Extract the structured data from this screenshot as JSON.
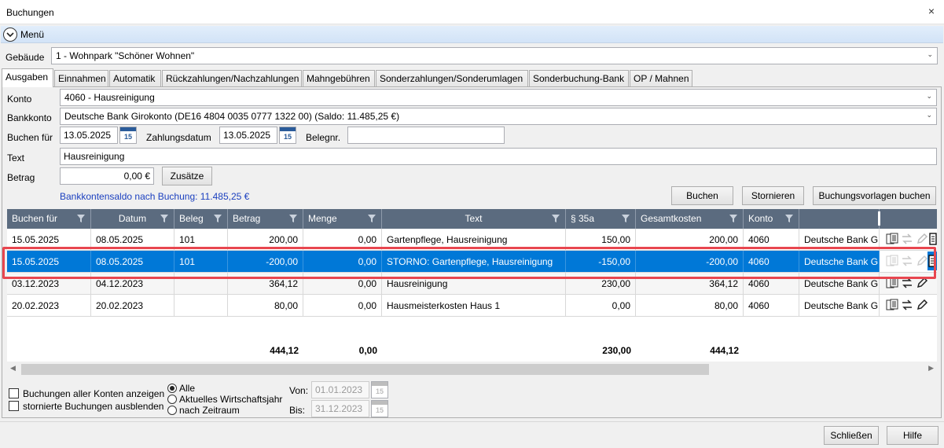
{
  "window": {
    "title": "Buchungen",
    "close_symbol": "×"
  },
  "menu": {
    "label": "Menü"
  },
  "building": {
    "label": "Gebäude",
    "value": "1 - Wohnpark \"Schöner Wohnen\""
  },
  "tabs": [
    {
      "label": "Ausgaben"
    },
    {
      "label": "Einnahmen"
    },
    {
      "label": "Automatik"
    },
    {
      "label": "Rückzahlungen/Nachzahlungen"
    },
    {
      "label": "Mahngebühren"
    },
    {
      "label": "Sonderzahlungen/Sonderumlagen"
    },
    {
      "label": "Sonderbuchung-Bank"
    },
    {
      "label": "OP / Mahnen"
    }
  ],
  "form": {
    "konto_label": "Konto",
    "konto_value": "4060 - Hausreinigung",
    "bankkonto_label": "Bankkonto",
    "bankkonto_value": "Deutsche Bank Girokonto (DE16 4804 0035 0777 1322 00) (Saldo: 11.485,25 €)",
    "buchen_fuer_label": "Buchen für",
    "buchen_fuer_value": "13.05.2025",
    "zahlungsdatum_label": "Zahlungsdatum",
    "zahlungsdatum_value": "13.05.2025",
    "belegnr_label": "Belegnr.",
    "belegnr_value": "",
    "text_label": "Text",
    "text_value": "Hausreinigung",
    "betrag_label": "Betrag",
    "betrag_value": "0,00 €",
    "zusaetze_button": "Zusätze",
    "saldo_info": "Bankkontensaldo nach Buchung: 11.485,25 €",
    "calendar_number": "15"
  },
  "buttons": {
    "buchen": "Buchen",
    "stornieren": "Stornieren",
    "vorlagen": "Buchungsvorlagen buchen",
    "schliessen": "Schließen",
    "hilfe": "Hilfe"
  },
  "grid": {
    "headers": [
      "Buchen für",
      "Datum",
      "Beleg",
      "Betrag",
      "Menge",
      "Text",
      "§ 35a",
      "Gesamtkosten",
      "Konto",
      ""
    ],
    "rows": [
      {
        "buchen_fuer": "15.05.2025",
        "datum": "08.05.2025",
        "beleg": "101",
        "betrag": "200,00",
        "menge": "0,00",
        "text": "Gartenpflege, Hausreinigung",
        "p35a": "150,00",
        "gesamtkosten": "200,00",
        "konto": "4060",
        "bank": "Deutsche Bank G"
      },
      {
        "buchen_fuer": "15.05.2025",
        "datum": "08.05.2025",
        "beleg": "101",
        "betrag": "-200,00",
        "menge": "0,00",
        "text": "STORNO: Gartenpflege, Hausreinigung",
        "p35a": "-150,00",
        "gesamtkosten": "-200,00",
        "konto": "4060",
        "bank": "Deutsche Bank G"
      },
      {
        "buchen_fuer": "03.12.2023",
        "datum": "04.12.2023",
        "beleg": "",
        "betrag": "364,12",
        "menge": "0,00",
        "text": "Hausreinigung",
        "p35a": "230,00",
        "gesamtkosten": "364,12",
        "konto": "4060",
        "bank": "Deutsche Bank G"
      },
      {
        "buchen_fuer": "20.02.2023",
        "datum": "20.02.2023",
        "beleg": "",
        "betrag": "80,00",
        "menge": "0,00",
        "text": "Hausmeisterkosten Haus 1",
        "p35a": "0,00",
        "gesamtkosten": "80,00",
        "konto": "4060",
        "bank": "Deutsche Bank G"
      }
    ],
    "totals": {
      "betrag": "444,12",
      "menge": "0,00",
      "p35a": "230,00",
      "gesamtkosten": "444,12"
    }
  },
  "options": {
    "all_accounts": "Buchungen aller Konten anzeigen",
    "hide_cancelled": "stornierte Buchungen ausblenden",
    "radio_all": "Alle",
    "radio_year": "Aktuelles Wirtschaftsjahr",
    "radio_period": "nach Zeitraum",
    "von_label": "Von:",
    "von_value": "01.01.2023",
    "bis_label": "Bis:",
    "bis_value": "31.12.2023"
  },
  "colors": {
    "accent": "#0078d7",
    "header": "#5b6b7f",
    "highlight": "#e8464f",
    "link": "#1a3fbf"
  }
}
